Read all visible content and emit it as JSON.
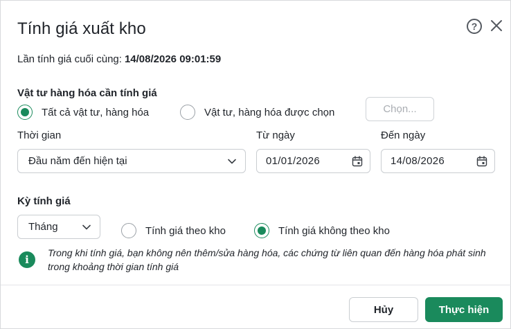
{
  "dialog": {
    "title": "Tính giá xuất kho",
    "last_calc_label": "Lần tính giá cuối cùng:",
    "last_calc_value": "14/08/2026 09:01:59"
  },
  "items_section": {
    "label": "Vật tư hàng hóa cần tính giá",
    "options": [
      {
        "label": "Tất cả vật tư, hàng hóa",
        "checked": true
      },
      {
        "label": "Vật tư, hàng hóa được chọn",
        "checked": false
      }
    ],
    "choose_label": "Chọn..."
  },
  "time": {
    "label": "Thời gian",
    "selected": "Đầu năm đến hiện tại"
  },
  "from_date": {
    "label": "Từ ngày",
    "value": "01/01/2026"
  },
  "to_date": {
    "label": "Đến ngày",
    "value": "14/08/2026"
  },
  "period": {
    "label": "Kỳ tính giá",
    "selected": "Tháng",
    "options": [
      {
        "label": "Tính giá theo kho",
        "checked": false
      },
      {
        "label": "Tính giá không theo kho",
        "checked": true
      }
    ]
  },
  "info": {
    "text": "Trong khi tính giá, bạn không nên thêm/sửa hàng hóa, các chứng từ liên quan đến hàng hóa phát sinh trong khoảng thời gian tính giá"
  },
  "footer": {
    "cancel_label": "Hủy",
    "submit_label": "Thực hiện"
  },
  "colors": {
    "accent": "#1a8a5c",
    "border": "#c9cdd1"
  }
}
